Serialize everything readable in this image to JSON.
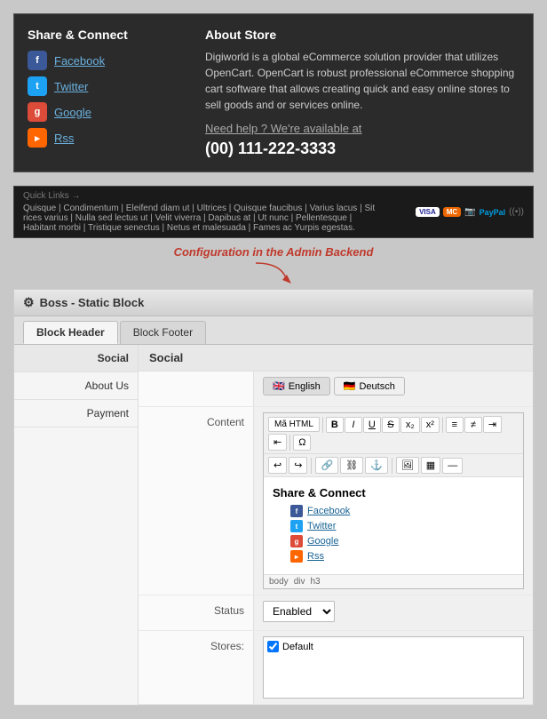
{
  "preview": {
    "share_title": "Share & Connect",
    "social_items": [
      {
        "name": "Facebook",
        "icon": "fb",
        "color": "#3b5998"
      },
      {
        "name": "Twitter",
        "icon": "tw",
        "color": "#1da1f2"
      },
      {
        "name": "Google",
        "icon": "gp",
        "color": "#dd4b39"
      },
      {
        "name": "Rss",
        "icon": "rss",
        "color": "#f60"
      }
    ],
    "about_title": "About Store",
    "about_text": "Digiworld is a global eCommerce solution provider that utilizes OpenCart. OpenCart is robust professional eCommerce shopping cart software that allows creating quick and easy online stores to sell goods and or services online.",
    "help_text": "Need help ? We're available at",
    "phone": "(00) 111-222-3333"
  },
  "quicklinks": {
    "label": "Quick Links →",
    "items": "Quisque | Condimentum | Eleifend diam ut | Ultrices | Quisque faucibus | Varius lacus | Sit rices varius | Nulla sed lectus ut | Velit viverra | Dapibus at | Ut nunc | Pellentesque | Habitant morbi | Tristique senectus | Netus et malesuada | Fames ac Yurpis egestas."
  },
  "arrow": {
    "label": "Configuration in the Admin Backend"
  },
  "admin": {
    "title": "Boss - Static Block",
    "tabs": [
      "Block Header",
      "Block Footer"
    ],
    "active_tab": "Block Header",
    "sidebar_items": [
      "Social",
      "About Us",
      "Payment"
    ],
    "active_sidebar": "Social",
    "section_title": "Social",
    "lang_tabs": [
      {
        "code": "en",
        "label": "English",
        "flag": "🇬🇧"
      },
      {
        "code": "de",
        "label": "Deutsch",
        "flag": "🇩🇪"
      }
    ],
    "rte": {
      "source_btn": "Mã HTML",
      "toolbar_btns": [
        "B",
        "I",
        "U",
        "S",
        "x₂",
        "x²"
      ],
      "content_title": "Share & Connect",
      "social_links": [
        {
          "name": "Facebook",
          "icon": "fb",
          "color": "#3b5998"
        },
        {
          "name": "Twitter",
          "icon": "tw",
          "color": "#1da1f2"
        },
        {
          "name": "Google",
          "icon": "gp",
          "color": "#dd4b39"
        },
        {
          "name": "Rss",
          "icon": "rss",
          "color": "#f60"
        }
      ],
      "statusbar": [
        "body",
        "div",
        "h3"
      ]
    },
    "status_label": "Status",
    "status_value": "Enabled",
    "stores_label": "Stores:",
    "default_store": "Default"
  }
}
